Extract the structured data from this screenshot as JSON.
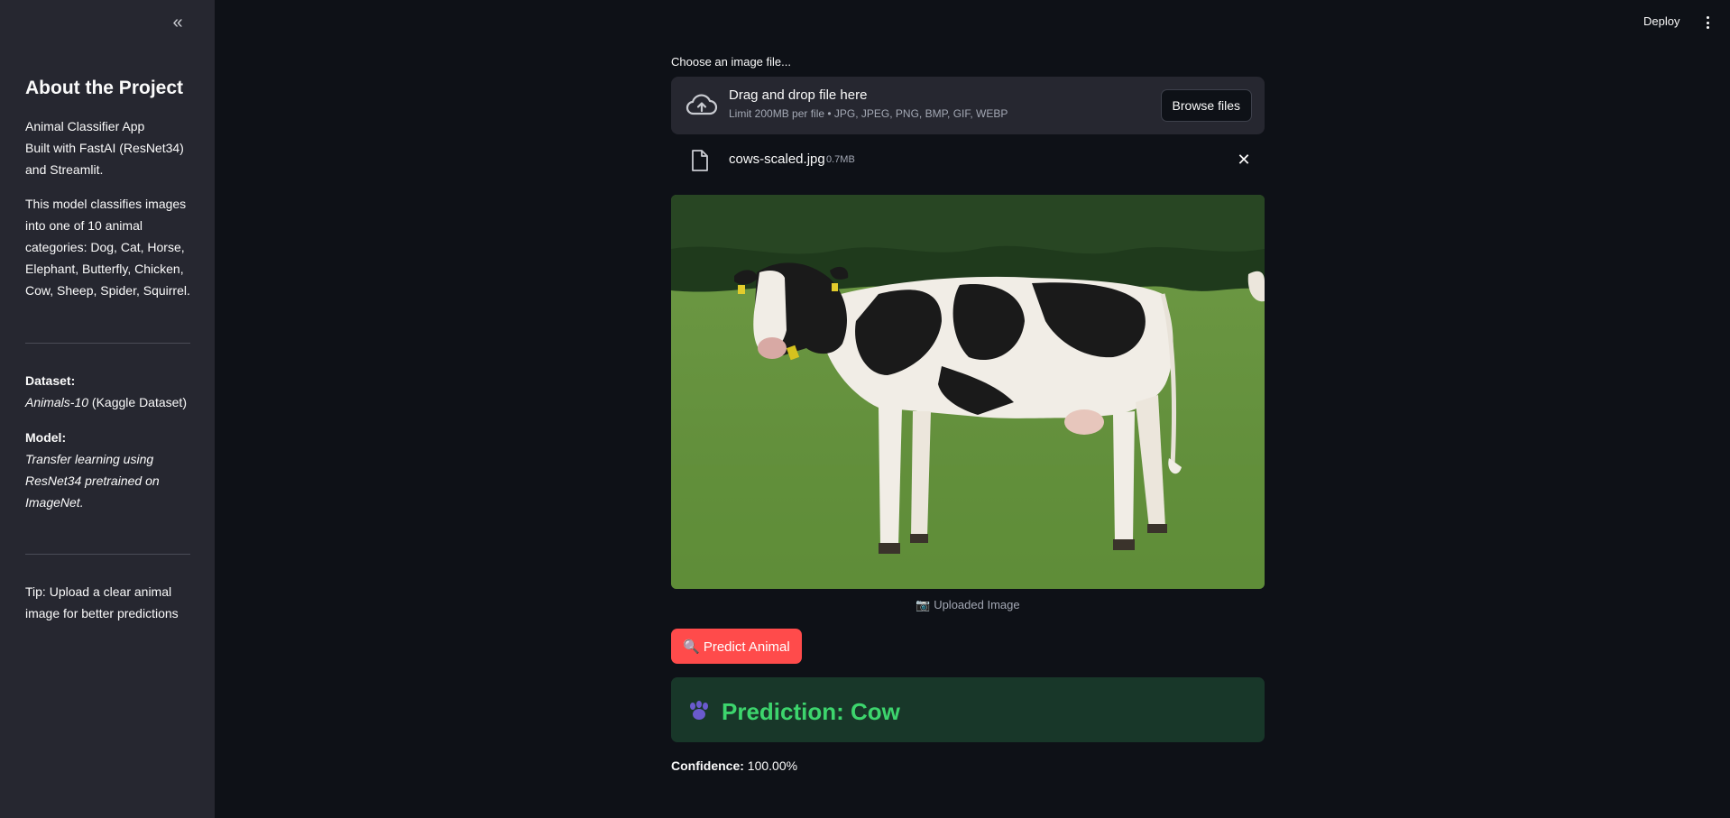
{
  "sidebar": {
    "collapse_glyph": "«",
    "title": "About the Project",
    "intro": [
      "Animal Classifier App",
      "Built with FastAI (ResNet34)",
      "and Streamlit."
    ],
    "description": [
      "This model classifies images",
      "into one of 10 animal",
      "categories: Dog, Cat, Horse,",
      "Elephant, Butterfly, Chicken,",
      "Cow, Sheep, Spider, Squirrel."
    ],
    "dataset_label": "Dataset:",
    "dataset_name": "Animals-10",
    "dataset_source": " (Kaggle Dataset)",
    "model_label": "Model:",
    "model_desc": [
      "Transfer learning using",
      "ResNet34 pretrained on",
      "ImageNet."
    ],
    "tip": [
      "Tip: Upload a clear animal",
      "image for better predictions"
    ]
  },
  "header": {
    "deploy_label": "Deploy"
  },
  "uploader": {
    "label": "Choose an image file...",
    "drop_title": "Drag and drop file here",
    "drop_sub": "Limit 200MB per file • JPG, JPEG, PNG, BMP, GIF, WEBP",
    "browse_label": "Browse files"
  },
  "file": {
    "name": "cows-scaled.jpg",
    "size": "0.7MB",
    "remove_glyph": "✕"
  },
  "image": {
    "caption": "📷 Uploaded Image"
  },
  "predict": {
    "label": "🔍 Predict Animal"
  },
  "result": {
    "text": "Prediction: Cow"
  },
  "confidence": {
    "label": "Confidence:",
    "value": " 100.00%"
  },
  "colors": {
    "background": "#0e1117",
    "sidebar": "#262730",
    "primary": "#ff4b4b",
    "success_bg": "#183729",
    "success_text": "#3dd56d"
  }
}
